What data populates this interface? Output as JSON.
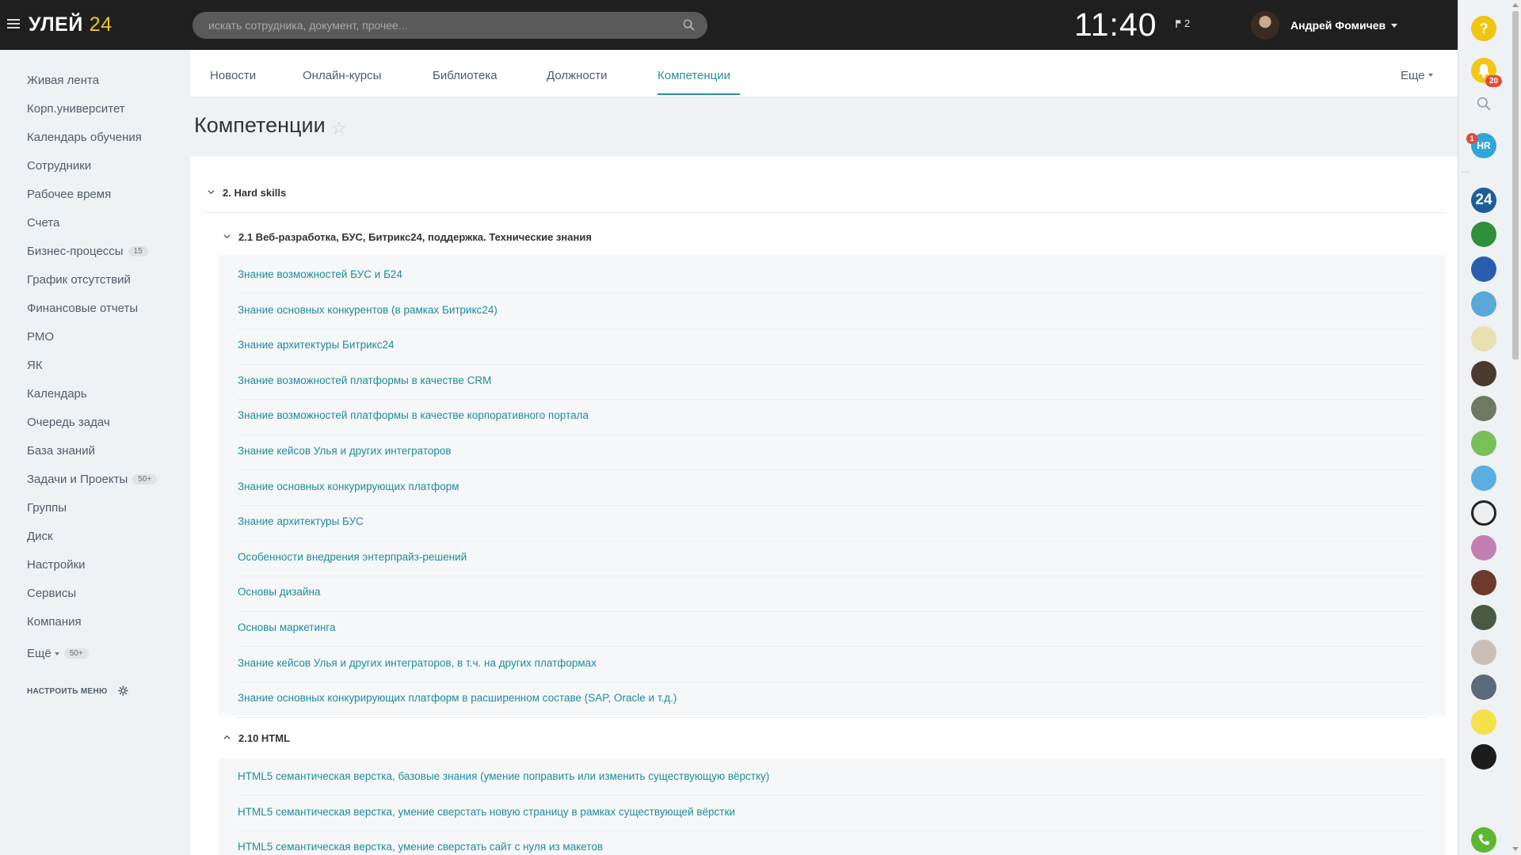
{
  "header": {
    "logo_main": "УЛЕЙ",
    "logo_num": "24",
    "search_placeholder": "искать сотрудника, документ, прочее...",
    "clock": "11:40",
    "flag_count": "2",
    "user_name": "Андрей Фомичев"
  },
  "sidebar": {
    "items": [
      {
        "label": "Живая лента"
      },
      {
        "label": "Корп.университет"
      },
      {
        "label": "Календарь обучения"
      },
      {
        "label": "Сотрудники"
      },
      {
        "label": "Рабочее время"
      },
      {
        "label": "Счета"
      },
      {
        "label": "Бизнес-процессы",
        "count": "15"
      },
      {
        "label": "График отсутствий"
      },
      {
        "label": "Финансовые отчеты"
      },
      {
        "label": "РМО"
      },
      {
        "label": "ЯК"
      },
      {
        "label": "Календарь"
      },
      {
        "label": "Очередь задач"
      },
      {
        "label": "База знаний"
      },
      {
        "label": "Задачи и Проекты",
        "count": "50+"
      },
      {
        "label": "Группы"
      },
      {
        "label": "Диск"
      },
      {
        "label": "Настройки"
      },
      {
        "label": "Сервисы"
      },
      {
        "label": "Компания"
      },
      {
        "label": "Ещё",
        "count": "50+"
      }
    ],
    "settings_label": "НАСТРОИТЬ МЕНЮ"
  },
  "tabs": [
    {
      "label": "Новости"
    },
    {
      "label": "Онлайн-курсы"
    },
    {
      "label": "Библиотека"
    },
    {
      "label": "Должности"
    },
    {
      "label": "Компетенции",
      "active": true
    }
  ],
  "more_label": "Еще",
  "page_title": "Компетенции",
  "sections": {
    "hard_skills": "2. Hard skills",
    "web_dev": "2.1 Веб-разработка, БУС, Битрикс24, поддержка. Технические знания",
    "html": "2.10 HTML"
  },
  "web_dev_items": [
    "Знание возможностей БУС и Б24",
    "Знание основных конкурентов (в рамках Битрикс24)",
    "Знание архитектуры Битрикс24",
    "Знание возможностей платформы в качестве CRM",
    "Знание возможностей платформы в качестве корпоративного портала",
    "Знание кейсов Улья и других интеграторов",
    "Знание основных конкурирующих платформ",
    "Знание архитектуры БУС",
    "Особенности внедрения энтерпрайз-решений",
    "Основы дизайна",
    "Основы маркетинга",
    "Знание кейсов Улья и других интеграторов, в т.ч. на других платформах",
    "Знание основных конкурирующих платформ в расширенном составе (SAP, Oracle и т.д.)"
  ],
  "html_items": [
    "HTML5 семантическая верстка, базовые знания (умение поправить или изменить существующую вёрстку)",
    "HTML5 семантическая верстка, умение сверстать новую страницу в рамках существующей вёрстки",
    "HTML5 семантическая верстка, умение сверстать сайт с нуля из макетов"
  ],
  "right_panel": {
    "help_label": "?",
    "notifications_count": "20",
    "hr_label": "HR",
    "hr_badge": "1",
    "b24_label": "24"
  },
  "colors": {
    "accent": "#2e8d9c",
    "link": "#1e8c9e",
    "header_bg": "#1f1f1f",
    "logo_yellow": "#f5c518"
  }
}
